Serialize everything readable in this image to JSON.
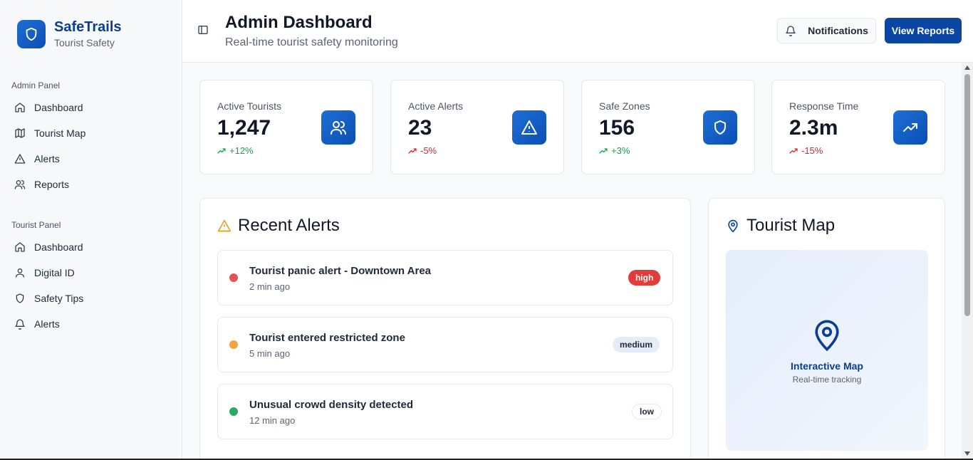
{
  "brand": {
    "name": "SafeTrails",
    "subtitle": "Tourist Safety"
  },
  "sidebar": {
    "admin_label": "Admin Panel",
    "admin_items": [
      {
        "label": "Dashboard",
        "icon": "home-icon"
      },
      {
        "label": "Tourist Map",
        "icon": "map-icon"
      },
      {
        "label": "Alerts",
        "icon": "alert-triangle-icon"
      },
      {
        "label": "Reports",
        "icon": "users-icon"
      }
    ],
    "tourist_label": "Tourist Panel",
    "tourist_items": [
      {
        "label": "Dashboard",
        "icon": "home-icon"
      },
      {
        "label": "Digital ID",
        "icon": "user-icon"
      },
      {
        "label": "Safety Tips",
        "icon": "shield-icon"
      },
      {
        "label": "Alerts",
        "icon": "bell-icon"
      }
    ]
  },
  "header": {
    "title": "Admin Dashboard",
    "subtitle": "Real-time tourist safety monitoring",
    "notifications_label": "Notifications",
    "reports_label": "View Reports"
  },
  "stats": [
    {
      "label": "Active Tourists",
      "value": "1,247",
      "change": "+12%",
      "trend": "up",
      "icon": "users-icon"
    },
    {
      "label": "Active Alerts",
      "value": "23",
      "change": "-5%",
      "trend": "down",
      "icon": "alert-triangle-icon"
    },
    {
      "label": "Safe Zones",
      "value": "156",
      "change": "+3%",
      "trend": "up",
      "icon": "shield-icon"
    },
    {
      "label": "Response Time",
      "value": "2.3m",
      "change": "-15%",
      "trend": "down",
      "icon": "trending-up-icon"
    }
  ],
  "alerts_panel": {
    "title": "Recent Alerts",
    "items": [
      {
        "title": "Tourist panic alert - Downtown Area",
        "time": "2 min ago",
        "severity": "high",
        "dot_color": "#e25555"
      },
      {
        "title": "Tourist entered restricted zone",
        "time": "5 min ago",
        "severity": "medium",
        "dot_color": "#f2a33a"
      },
      {
        "title": "Unusual crowd density detected",
        "time": "12 min ago",
        "severity": "low",
        "dot_color": "#2fa865"
      }
    ]
  },
  "map_panel": {
    "title": "Tourist Map",
    "label": "Interactive Map",
    "sublabel": "Real-time tracking"
  },
  "colors": {
    "brand": "#0b3d91",
    "primary_button": "#0b46a3",
    "positive": "#16a34a",
    "negative": "#dc2626"
  }
}
